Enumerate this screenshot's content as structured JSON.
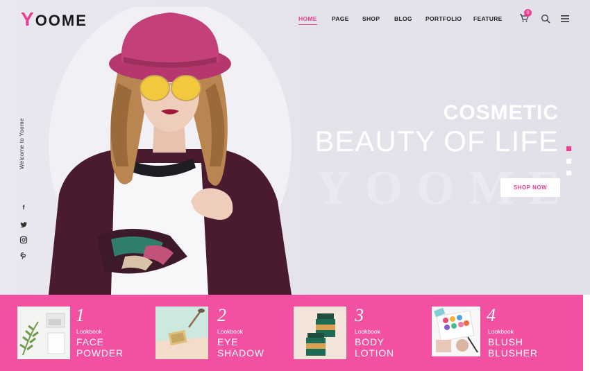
{
  "brand": {
    "logo_initial": "Y",
    "logo_rest": "OOME"
  },
  "nav": [
    "HOME",
    "PAGE",
    "SHOP",
    "BLOG",
    "PORTFOLIO",
    "FEATURE"
  ],
  "cart": {
    "count": "0",
    "icon": "cart-icon"
  },
  "icons": {
    "search": "search-icon",
    "menu": "menu-icon"
  },
  "side": {
    "welcome": "Welcome to Yoome",
    "social": [
      {
        "icon": "facebook-icon",
        "glyph": "f"
      },
      {
        "icon": "twitter-icon",
        "glyph": "🐦"
      },
      {
        "icon": "instagram-icon",
        "glyph": "◎"
      },
      {
        "icon": "pinterest-icon",
        "glyph": "p"
      }
    ]
  },
  "hero": {
    "heading_small": "COSMETIC",
    "heading_large": "BEAUTY OF LIFE",
    "watermark": "YOOME",
    "cta": "SHOP NOW",
    "slides": 3,
    "active_slide": 1
  },
  "colors": {
    "accent": "#ec3f93",
    "band": "#f250a1",
    "background": "#e6e4ed"
  },
  "lookbook": [
    {
      "num": "1",
      "label": "Lookbook",
      "line1": "FACE",
      "line2": "POWDER"
    },
    {
      "num": "2",
      "label": "Lookbook",
      "line1": "EYE",
      "line2": "SHADOW"
    },
    {
      "num": "3",
      "label": "Lookbook",
      "line1": "BODY",
      "line2": "LOTION"
    },
    {
      "num": "4",
      "label": "Lookbook",
      "line1": "BLUSH",
      "line2": "BLUSHER"
    }
  ]
}
